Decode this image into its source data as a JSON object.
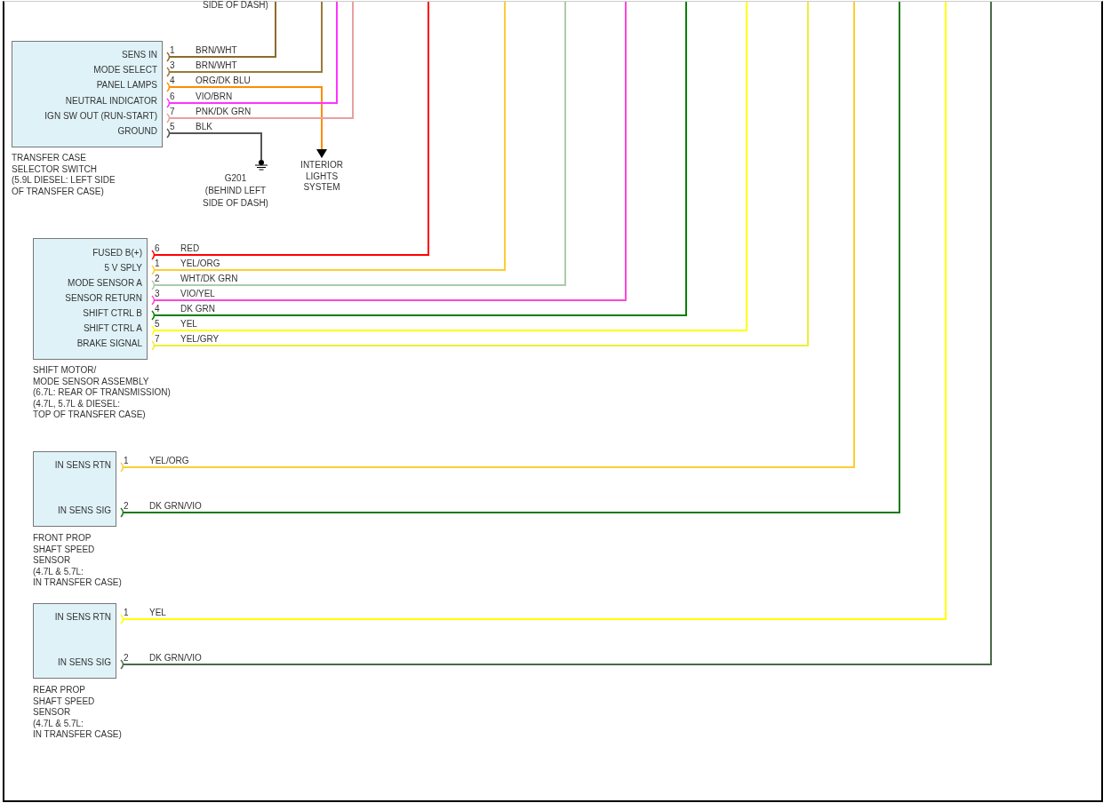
{
  "top_label": "SIDE OF DASH)",
  "components": [
    {
      "caption": [
        "TRANSFER CASE",
        "SELECTOR SWITCH",
        "(5.9L DIESEL: LEFT SIDE",
        "OF TRANSFER CASE)"
      ],
      "pins": [
        {
          "label": "SENS IN",
          "number": "1",
          "wire": "BRN/WHT",
          "color": "#8b6a2b"
        },
        {
          "label": "MODE SELECT",
          "number": "3",
          "wire": "BRN/WHT",
          "color": "#9a7a3a"
        },
        {
          "label": "PANEL LAMPS",
          "number": "4",
          "wire": "ORG/DK BLU",
          "color": "#ff8c00"
        },
        {
          "label": "NEUTRAL INDICATOR",
          "number": "6",
          "wire": "VIO/BRN",
          "color": "#ff33ff"
        },
        {
          "label": "IGN SW OUT (RUN-START)",
          "number": "7",
          "wire": "PNK/DK GRN",
          "color": "#e8a0a0"
        },
        {
          "label": "GROUND",
          "number": "5",
          "wire": "BLK",
          "color": "#555555"
        }
      ]
    },
    {
      "caption": [
        "SHIFT MOTOR/",
        "MODE SENSOR ASSEMBLY",
        "(6.7L: REAR OF TRANSMISSION)",
        "(4.7L, 5.7L & DIESEL:",
        "TOP OF TRANSFER CASE)"
      ],
      "pins": [
        {
          "label": "FUSED B(+)",
          "number": "6",
          "wire": "RED",
          "color": "#ff0000"
        },
        {
          "label": "5 V SPLY",
          "number": "1",
          "wire": "YEL/ORG",
          "color": "#ffcc33"
        },
        {
          "label": "MODE SENSOR A",
          "number": "2",
          "wire": "WHT/DK GRN",
          "color": "#aaccaa"
        },
        {
          "label": "SENSOR RETURN",
          "number": "3",
          "wire": "VIO/YEL",
          "color": "#ff44dd"
        },
        {
          "label": "SHIFT CTRL B",
          "number": "4",
          "wire": "DK GRN",
          "color": "#008000"
        },
        {
          "label": "SHIFT CTRL A",
          "number": "5",
          "wire": "YEL",
          "color": "#ffff00"
        },
        {
          "label": "BRAKE SIGNAL",
          "number": "7",
          "wire": "YEL/GRY",
          "color": "#eeee33"
        }
      ]
    },
    {
      "caption": [
        "FRONT PROP",
        "SHAFT SPEED",
        "SENSOR",
        "(4.7L & 5.7L:",
        "IN TRANSFER CASE)"
      ],
      "pins": [
        {
          "label": "IN SENS RTN",
          "number": "1",
          "wire": "YEL/ORG",
          "color": "#ffcc33"
        },
        {
          "label": "IN SENS SIG",
          "number": "2",
          "wire": "DK GRN/VIO",
          "color": "#1a7a1a"
        }
      ]
    },
    {
      "caption": [
        "REAR PROP",
        "SHAFT SPEED",
        "SENSOR",
        "(4.7L & 5.7L:",
        "IN TRANSFER CASE)"
      ],
      "pins": [
        {
          "label": "IN SENS RTN",
          "number": "1",
          "wire": "YEL",
          "color": "#ffff00"
        },
        {
          "label": "IN SENS SIG",
          "number": "2",
          "wire": "DK GRN/VIO",
          "color": "#4a6a4a"
        }
      ]
    }
  ],
  "ground": {
    "name": "G201",
    "location": [
      "(BEHIND LEFT",
      "SIDE OF DASH)"
    ]
  },
  "destination": [
    "INTERIOR",
    "LIGHTS",
    "SYSTEM"
  ]
}
